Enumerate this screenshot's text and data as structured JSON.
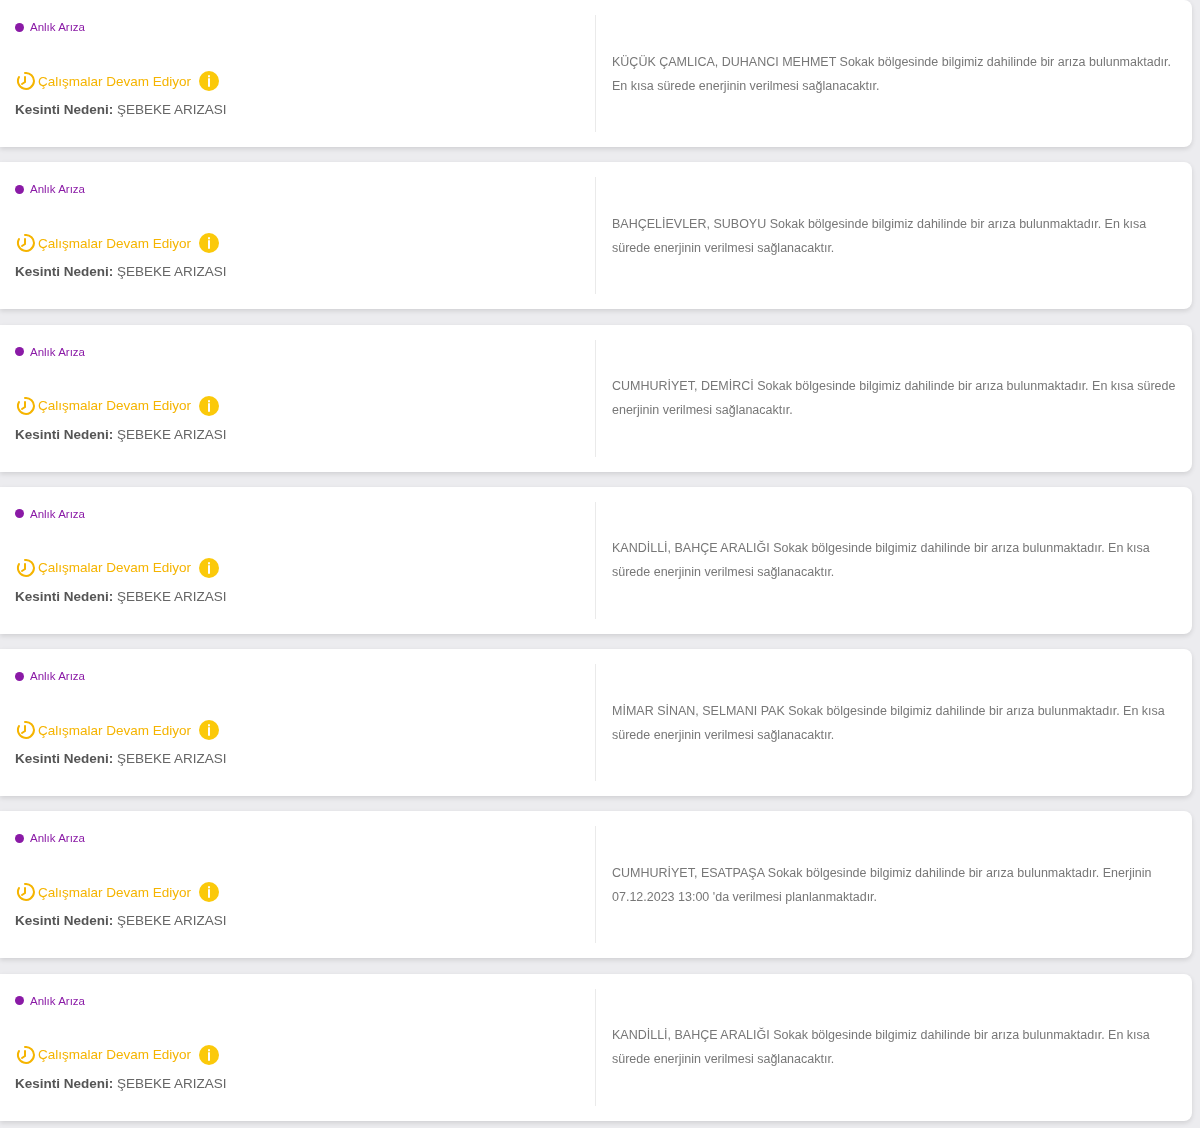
{
  "outages": [
    {
      "type": "Anlık Arıza",
      "status": "Çalışmalar Devam Ediyor",
      "reason_label": "Kesinti Nedeni:",
      "reason": "ŞEBEKE ARIZASI",
      "description": "KÜÇÜK ÇAMLICA, DUHANCI MEHMET Sokak bölgesinde bilgimiz dahilinde bir arıza bulunmaktadır. En kısa sürede enerjinin verilmesi sağlanacaktır."
    },
    {
      "type": "Anlık Arıza",
      "status": "Çalışmalar Devam Ediyor",
      "reason_label": "Kesinti Nedeni:",
      "reason": "ŞEBEKE ARIZASI",
      "description": "BAHÇELİEVLER, SUBOYU Sokak bölgesinde bilgimiz dahilinde bir arıza bulunmaktadır. En kısa sürede enerjinin verilmesi sağlanacaktır."
    },
    {
      "type": "Anlık Arıza",
      "status": "Çalışmalar Devam Ediyor",
      "reason_label": "Kesinti Nedeni:",
      "reason": "ŞEBEKE ARIZASI",
      "description": "CUMHURİYET, DEMİRCİ Sokak bölgesinde bilgimiz dahilinde bir arıza bulunmaktadır. En kısa sürede enerjinin verilmesi sağlanacaktır."
    },
    {
      "type": "Anlık Arıza",
      "status": "Çalışmalar Devam Ediyor",
      "reason_label": "Kesinti Nedeni:",
      "reason": "ŞEBEKE ARIZASI",
      "description": "KANDİLLİ, BAHÇE ARALIĞI Sokak bölgesinde bilgimiz dahilinde bir arıza bulunmaktadır. En kısa sürede enerjinin verilmesi sağlanacaktır."
    },
    {
      "type": "Anlık Arıza",
      "status": "Çalışmalar Devam Ediyor",
      "reason_label": "Kesinti Nedeni:",
      "reason": "ŞEBEKE ARIZASI",
      "description": "MİMAR SİNAN, SELMANI PAK Sokak bölgesinde bilgimiz dahilinde bir arıza bulunmaktadır. En kısa sürede enerjinin verilmesi sağlanacaktır."
    },
    {
      "type": "Anlık Arıza",
      "status": "Çalışmalar Devam Ediyor",
      "reason_label": "Kesinti Nedeni:",
      "reason": "ŞEBEKE ARIZASI",
      "description": "CUMHURİYET, ESATPAŞA Sokak bölgesinde bilgimiz dahilinde bir arıza bulunmaktadır. Enerjinin 07.12.2023 13:00 'da verilmesi planlanmaktadır."
    },
    {
      "type": "Anlık Arıza",
      "status": "Çalışmalar Devam Ediyor",
      "reason_label": "Kesinti Nedeni:",
      "reason": "ŞEBEKE ARIZASI",
      "description": "KANDİLLİ, BAHÇE ARALIĞI Sokak bölgesinde bilgimiz dahilinde bir arıza bulunmaktadır. En kısa sürede enerjinin verilmesi sağlanacaktır."
    }
  ]
}
